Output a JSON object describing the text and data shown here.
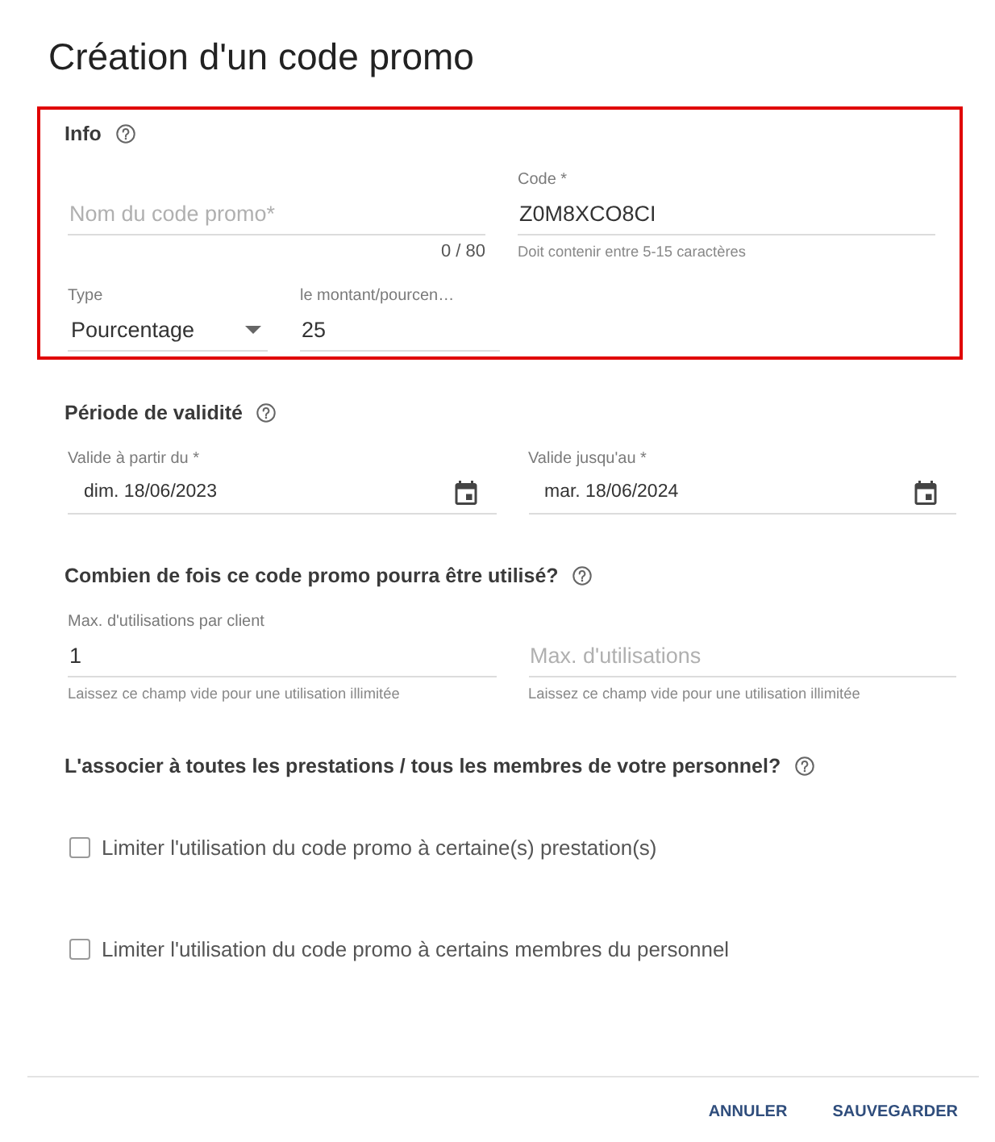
{
  "dialog": {
    "title": "Création d'un code promo"
  },
  "sections": [
    {
      "title": "Info",
      "help": true,
      "highlighted": true,
      "rows": [
        {
          "kind": "halves",
          "fields": [
            {
              "kind": "text",
              "placeholder": "Nom du code promo*",
              "counter": "0 / 80"
            },
            {
              "kind": "text",
              "label": "Code *",
              "value": "Z0M8XCO8CI",
              "hint": "Doit contenir entre 5-15 caractères"
            }
          ]
        },
        {
          "kind": "quarters",
          "fields": [
            {
              "kind": "select",
              "label": "Type",
              "value": "Pourcentage"
            },
            {
              "kind": "text",
              "label": "le montant/pourcen…",
              "value": "25"
            }
          ]
        }
      ]
    },
    {
      "title": "Période de validité",
      "help": true,
      "highlighted": false,
      "rows": [
        {
          "kind": "halves",
          "fields": [
            {
              "kind": "date",
              "label": "Valide à partir du *",
              "value": "dim. 18/06/2023"
            },
            {
              "kind": "date",
              "label": "Valide jusqu'au *",
              "value": "mar. 18/06/2024"
            }
          ]
        }
      ]
    },
    {
      "title": "Combien de fois ce code promo pourra être utilisé?",
      "help": true,
      "highlighted": false,
      "rows": [
        {
          "kind": "halves",
          "fields": [
            {
              "kind": "text",
              "label": "Max. d'utilisations par client",
              "value": "1",
              "hint": "Laissez ce champ vide pour une utilisation illimitée"
            },
            {
              "kind": "text",
              "placeholder": "Max. d'utilisations",
              "hint": "Laissez ce champ vide pour une utilisation illimitée"
            }
          ]
        }
      ]
    },
    {
      "title": "L'associer à toutes les prestations / tous les membres de votre personnel?",
      "help": true,
      "highlighted": false,
      "checkboxes": [
        {
          "label": "Limiter l'utilisation du code promo à certaine(s) prestation(s)",
          "checked": false
        },
        {
          "label": "Limiter l'utilisation du code promo à certains membres du personnel",
          "checked": false
        }
      ]
    }
  ],
  "buttons": [
    "ANNULER",
    "SAUVEGARDER"
  ]
}
